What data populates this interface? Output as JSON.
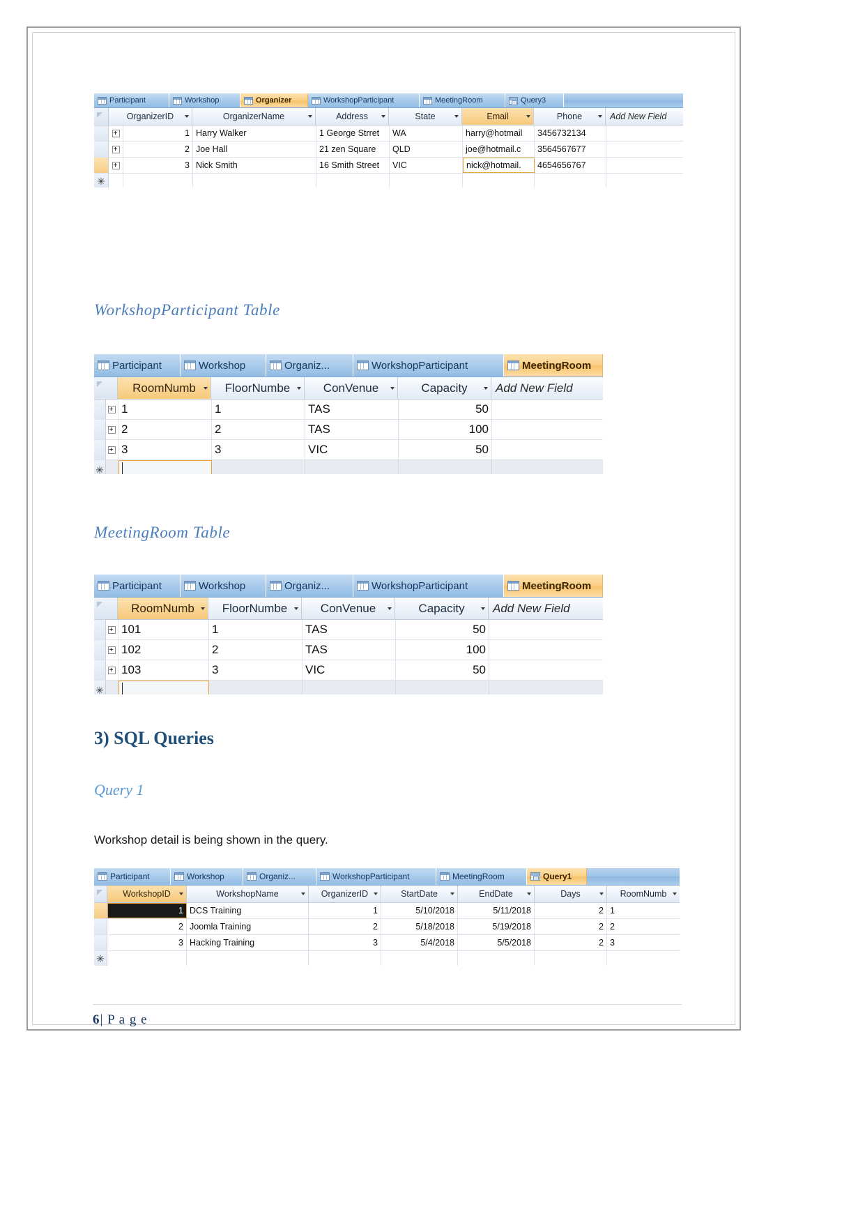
{
  "page": {
    "footer_number": "6",
    "footer_separator": "|",
    "footer_label": "P a g e"
  },
  "headings": {
    "workshop_participant_table": "WorkshopParticipant Table",
    "meeting_room_table": "MeetingRoom Table",
    "sql_queries": "3) SQL Queries",
    "query_1": "Query 1"
  },
  "paragraphs": {
    "query1_desc": "Workshop detail is being shown in the query."
  },
  "colors": {
    "heading_accent": "#4a7ebb",
    "heading_main": "#1f4e79",
    "tab_active": "#f8c46c",
    "selection": "#e8a33d"
  },
  "organizer_table": {
    "tabs": [
      {
        "label": "Participant",
        "icon": "table-icon",
        "active": false
      },
      {
        "label": "Workshop",
        "icon": "table-icon",
        "active": false
      },
      {
        "label": "Organizer",
        "icon": "table-icon",
        "active": true
      },
      {
        "label": "WorkshopParticipant",
        "icon": "table-icon",
        "active": false
      },
      {
        "label": "MeetingRoom",
        "icon": "table-icon",
        "active": false
      },
      {
        "label": "Query3",
        "icon": "query-icon",
        "active": false
      }
    ],
    "columns": [
      {
        "label": "OrganizerID",
        "selected": false,
        "caret": true
      },
      {
        "label": "OrganizerName",
        "selected": false,
        "caret": true
      },
      {
        "label": "Address",
        "selected": false,
        "caret": true
      },
      {
        "label": "State",
        "selected": false,
        "caret": true
      },
      {
        "label": "Email",
        "selected": true,
        "caret": true
      },
      {
        "label": "Phone",
        "selected": false,
        "caret": true
      },
      {
        "label": "Add New Field",
        "selected": false,
        "caret": false
      }
    ],
    "rows": [
      {
        "OrganizerID": "1",
        "OrganizerName": "Harry Walker",
        "Address": "1 George Strret",
        "State": "WA",
        "Email": "harry@hotmail",
        "Phone": "3456732134"
      },
      {
        "OrganizerID": "2",
        "OrganizerName": "Joe Hall",
        "Address": "21 zen Square",
        "State": "QLD",
        "Email": "joe@hotmail.c",
        "Phone": "3564567677"
      },
      {
        "OrganizerID": "3",
        "OrganizerName": "Nick Smith",
        "Address": "16 Smith Street",
        "State": "VIC",
        "Email": "nick@hotmail.",
        "Phone": "4654656767"
      }
    ],
    "new_record_marker": "✳"
  },
  "workshop_participant_table": {
    "tabs": [
      {
        "label": "Participant",
        "icon": "table-icon",
        "active": false
      },
      {
        "label": "Workshop",
        "icon": "table-icon",
        "active": false
      },
      {
        "label": "Organiz...",
        "icon": "table-icon",
        "active": false
      },
      {
        "label": "WorkshopParticipant",
        "icon": "table-icon",
        "active": false
      },
      {
        "label": "MeetingRoom",
        "icon": "table-icon",
        "active": true
      }
    ],
    "columns": [
      {
        "label": "RoomNumb",
        "selected": true,
        "caret": true
      },
      {
        "label": "FloorNumbe",
        "selected": false,
        "caret": true
      },
      {
        "label": "ConVenue",
        "selected": false,
        "caret": true
      },
      {
        "label": "Capacity",
        "selected": false,
        "caret": true
      },
      {
        "label": "Add New Field",
        "selected": false,
        "caret": false
      }
    ],
    "rows": [
      {
        "RoomNumb": "1",
        "FloorNumbe": "1",
        "ConVenue": "TAS",
        "Capacity": "50"
      },
      {
        "RoomNumb": "2",
        "FloorNumbe": "2",
        "ConVenue": "TAS",
        "Capacity": "100"
      },
      {
        "RoomNumb": "3",
        "FloorNumbe": "3",
        "ConVenue": "VIC",
        "Capacity": "50"
      }
    ],
    "new_record_marker": "✳"
  },
  "meeting_room_table": {
    "tabs": [
      {
        "label": "Participant",
        "icon": "table-icon",
        "active": false
      },
      {
        "label": "Workshop",
        "icon": "table-icon",
        "active": false
      },
      {
        "label": "Organiz...",
        "icon": "table-icon",
        "active": false
      },
      {
        "label": "WorkshopParticipant",
        "icon": "table-icon",
        "active": false
      },
      {
        "label": "MeetingRoom",
        "icon": "table-icon",
        "active": true
      }
    ],
    "columns": [
      {
        "label": "RoomNumb",
        "selected": true,
        "caret": true
      },
      {
        "label": "FloorNumbe",
        "selected": false,
        "caret": true
      },
      {
        "label": "ConVenue",
        "selected": false,
        "caret": true
      },
      {
        "label": "Capacity",
        "selected": false,
        "caret": true
      },
      {
        "label": "Add New Field",
        "selected": false,
        "caret": false
      }
    ],
    "rows": [
      {
        "RoomNumb": "101",
        "FloorNumbe": "1",
        "ConVenue": "TAS",
        "Capacity": "50"
      },
      {
        "RoomNumb": "102",
        "FloorNumbe": "2",
        "ConVenue": "TAS",
        "Capacity": "100"
      },
      {
        "RoomNumb": "103",
        "FloorNumbe": "3",
        "ConVenue": "VIC",
        "Capacity": "50"
      }
    ],
    "new_record_marker": "✳"
  },
  "query1_table": {
    "tabs": [
      {
        "label": "Participant",
        "icon": "table-icon",
        "active": false
      },
      {
        "label": "Workshop",
        "icon": "table-icon",
        "active": false
      },
      {
        "label": "Organiz...",
        "icon": "table-icon",
        "active": false
      },
      {
        "label": "WorkshopParticipant",
        "icon": "table-icon",
        "active": false
      },
      {
        "label": "MeetingRoom",
        "icon": "table-icon",
        "active": false
      },
      {
        "label": "Query1",
        "icon": "query-icon",
        "active": true
      }
    ],
    "columns": [
      {
        "label": "WorkshopID",
        "selected": true,
        "caret": true
      },
      {
        "label": "WorkshopName",
        "selected": false,
        "caret": true
      },
      {
        "label": "OrganizerID",
        "selected": false,
        "caret": true
      },
      {
        "label": "StartDate",
        "selected": false,
        "caret": true
      },
      {
        "label": "EndDate",
        "selected": false,
        "caret": true
      },
      {
        "label": "Days",
        "selected": false,
        "caret": true
      },
      {
        "label": "RoomNumb",
        "selected": false,
        "caret": true
      }
    ],
    "rows": [
      {
        "WorkshopID": "1",
        "WorkshopName": "DCS Training",
        "OrganizerID": "1",
        "StartDate": "5/10/2018",
        "EndDate": "5/11/2018",
        "Days": "2",
        "RoomNumb": "1"
      },
      {
        "WorkshopID": "2",
        "WorkshopName": "Joomla Training",
        "OrganizerID": "2",
        "StartDate": "5/18/2018",
        "EndDate": "5/19/2018",
        "Days": "2",
        "RoomNumb": "2"
      },
      {
        "WorkshopID": "3",
        "WorkshopName": "Hacking Training",
        "OrganizerID": "3",
        "StartDate": "5/4/2018",
        "EndDate": "5/5/2018",
        "Days": "2",
        "RoomNumb": "3"
      }
    ],
    "new_record_marker": "✳"
  }
}
